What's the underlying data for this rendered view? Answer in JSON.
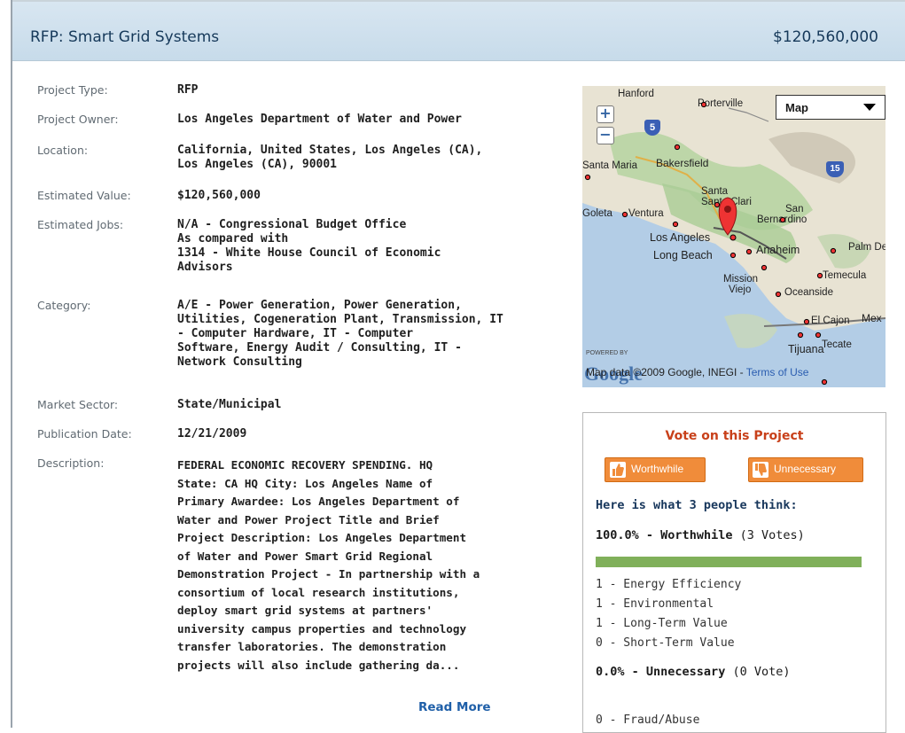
{
  "header": {
    "title": "RFP: Smart Grid Systems",
    "value": "$120,560,000"
  },
  "details": {
    "project_type": {
      "label": "Project Type:",
      "value": "RFP"
    },
    "project_owner": {
      "label": "Project Owner:",
      "value": "Los Angeles Department of Water and Power"
    },
    "location": {
      "label": "Location:",
      "lines": [
        "California, United States, Los Angeles (CA),",
        "Los Angeles (CA), 90001"
      ]
    },
    "estimated_value": {
      "label": "Estimated Value:",
      "value": "$120,560,000"
    },
    "estimated_jobs": {
      "label": "Estimated Jobs:",
      "lines": [
        "N/A - Congressional Budget Office",
        "As compared with",
        "1314 - White House Council of Economic",
        "Advisors"
      ]
    },
    "category": {
      "label": "Category:",
      "lines": [
        "A/E - Power Generation, Power Generation,",
        "Utilities, Cogeneration Plant, Transmission, IT",
        "- Computer Hardware, IT - Computer",
        "Software, Energy Audit / Consulting, IT -",
        "Network Consulting"
      ]
    },
    "market_sector": {
      "label": "Market Sector:",
      "value": "State/Municipal"
    },
    "publication_date": {
      "label": "Publication Date:",
      "value": "12/21/2009"
    },
    "description": {
      "label": "Description:",
      "lines": [
        "FEDERAL ECONOMIC RECOVERY SPENDING. HQ",
        "State: CA HQ City: Los Angeles Name of",
        "Primary Awardee: Los Angeles Department of",
        "Water and Power Project Title and Brief",
        "Project Description: Los Angeles Department",
        "of Water and Power Smart Grid Regional",
        "Demonstration Project - In partnership with a",
        "consortium of local research institutions,",
        "deploy smart grid systems at partners'",
        "university campus properties and technology",
        "transfer laboratories. The demonstration",
        "projects will also include gathering da..."
      ],
      "read_more": "Read More"
    }
  },
  "map": {
    "type_select": "Map",
    "zoom_in": "+",
    "zoom_out": "−",
    "cities": {
      "hanford": "Hanford",
      "porterville": "Porterville",
      "santa_maria": "Santa Maria",
      "bakersfield": "Bakersfield",
      "santa_clarita": "Santa Clari",
      "santa_top": "Santa",
      "goleta": "Goleta",
      "ventura": "Ventura",
      "san": "San",
      "bernardino": "Bernardino",
      "los_angeles": "Los Angeles",
      "palm": "Palm De",
      "long_beach": "Long Beach",
      "anaheim": "Anaheim",
      "temecula": "Temecula",
      "mission": "Mission",
      "viejo": "Viejo",
      "oceanside": "Oceanside",
      "el_cajon": "El Cajon",
      "mex": "Mex",
      "tijuana": "Tijuana",
      "tecate": "Tecate"
    },
    "highway_5": "5",
    "highway_15": "15",
    "powered_by": "POWERED BY",
    "google": "Google",
    "attribution": "Map data ©2009 Google, INEGI - ",
    "terms": "Terms of Use"
  },
  "vote": {
    "title": "Vote on this Project",
    "worthwhile_button": "Worthwhile",
    "unnecessary_button": "Unnecessary",
    "think": "Here is what 3 people think:",
    "worthwhile_pct": "100.0%",
    "worthwhile_label": "- Worthwhile",
    "worthwhile_votes": "(3 Votes)",
    "worthwhile_fraction": 1.0,
    "worthwhile_items": [
      "1 - Energy Efficiency",
      "1 - Environmental",
      "1 - Long-Term Value",
      "0 - Short-Term Value"
    ],
    "unnecessary_pct": "0.0%",
    "unnecessary_label": "- Unnecessary",
    "unnecessary_votes": "(0 Vote)",
    "unnecessary_items": [
      "0 - Fraud/Abuse"
    ]
  }
}
